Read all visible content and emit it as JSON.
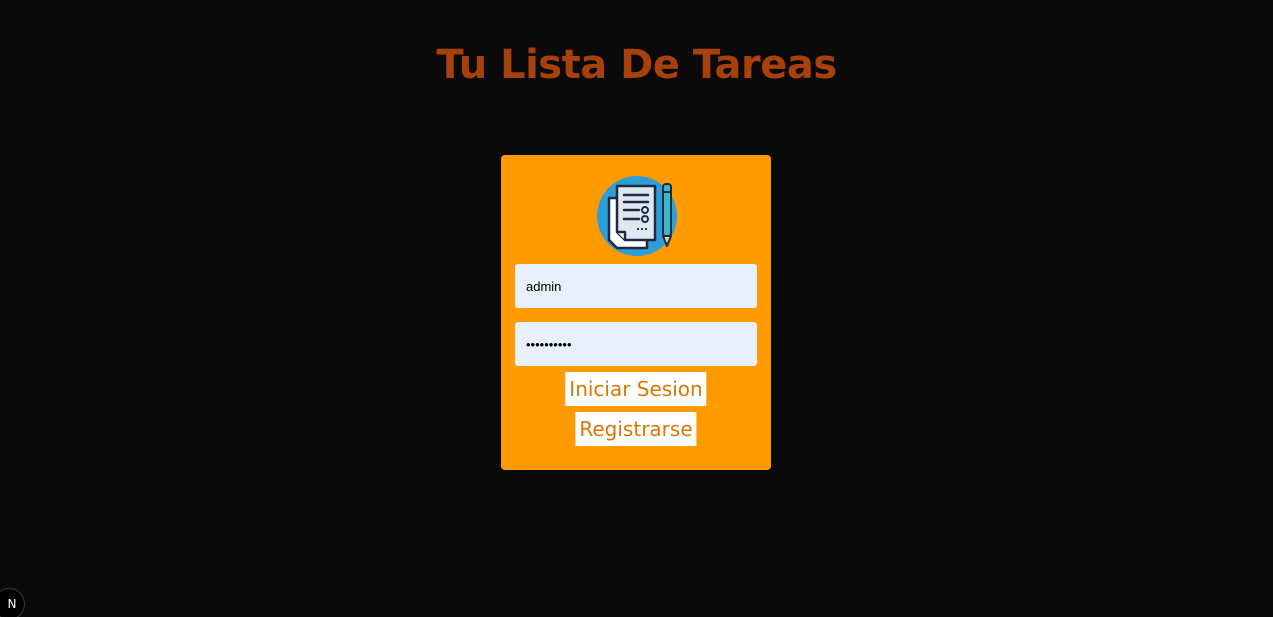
{
  "page": {
    "title": "Tu Lista De Tareas"
  },
  "login_form": {
    "logo_icon": "task-list-document-with-pen-icon",
    "username_value": "admin",
    "password_value": "••••••••••",
    "login_button_label": "Iniciar Sesion",
    "register_button_label": "Registrarse"
  },
  "dev_badge": {
    "label": "N",
    "icon": "nextjs-logo-icon"
  },
  "colors": {
    "background": "#0a0a0a",
    "title": "#a8400c",
    "card": "#ff9b00",
    "input_bg": "#e8f0fe",
    "button_text": "#d97706",
    "button_bg": "#ffffff"
  }
}
